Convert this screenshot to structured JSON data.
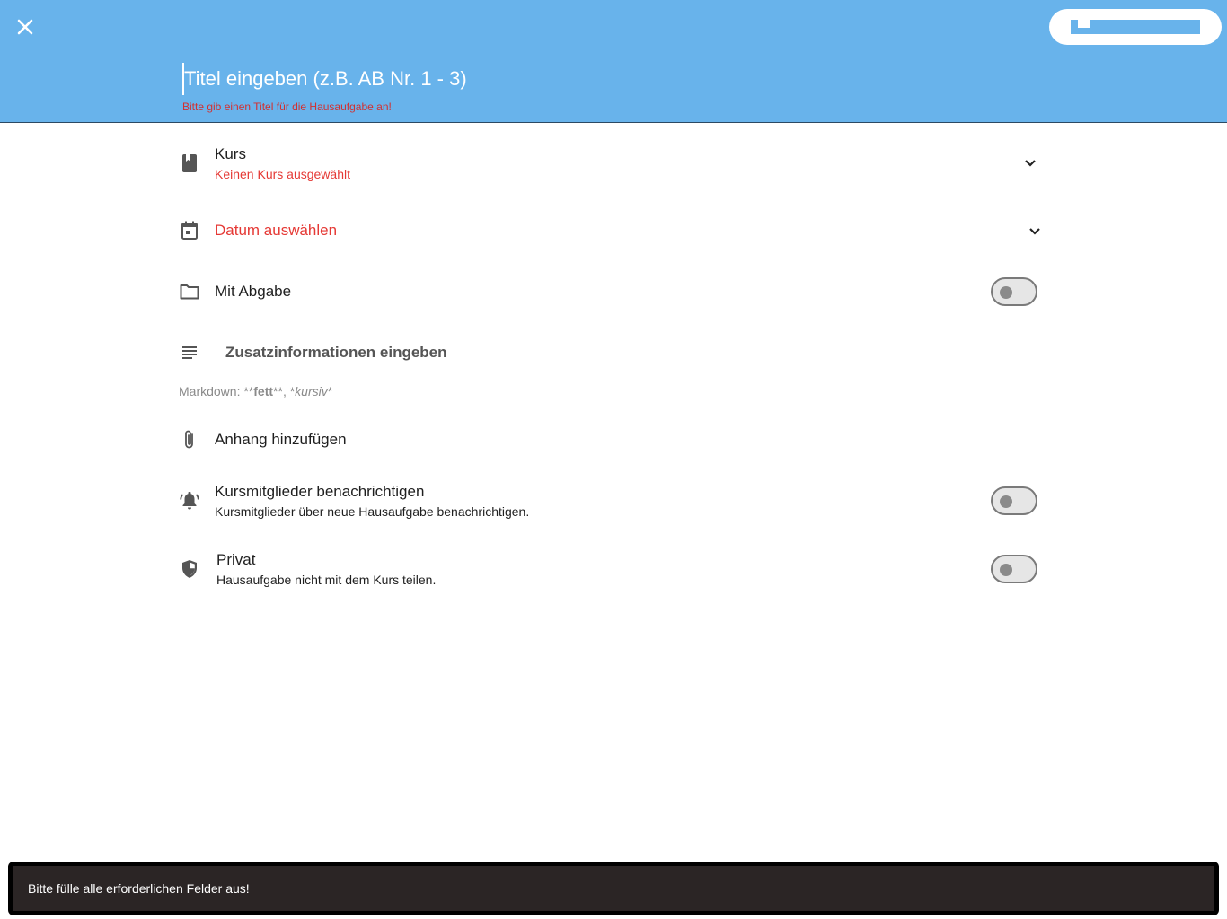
{
  "header": {
    "close_icon": "close-icon",
    "title_placeholder": "Titel eingeben (z.B. AB Nr. 1 - 3)",
    "title_error": "Bitte gib einen Titel für die Hausaufgabe an!",
    "background_color": "#68b3eb"
  },
  "form": {
    "course": {
      "icon": "book-icon",
      "label": "Kurs",
      "status": "Keinen Kurs ausgewählt"
    },
    "date": {
      "icon": "calendar-icon",
      "label": "Datum auswählen"
    },
    "submission": {
      "icon": "folder-icon",
      "label": "Mit Abgabe",
      "enabled": false
    },
    "description": {
      "icon": "notes-icon",
      "placeholder": "Zusatzinformationen eingeben",
      "markdown_prefix": "Markdown: **",
      "markdown_bold": "fett",
      "markdown_middle": "**, *",
      "markdown_italic": "kursiv",
      "markdown_suffix": "*"
    },
    "attachment": {
      "icon": "paperclip-icon",
      "label": "Anhang hinzufügen"
    },
    "notify": {
      "icon": "bell-ring-icon",
      "label": "Kursmitglieder benachrichtigen",
      "sub": "Kursmitglieder über neue Hausaufgabe benachrichtigen.",
      "enabled": false
    },
    "private": {
      "icon": "shield-icon",
      "label": "Privat",
      "sub": "Hausaufgabe nicht mit dem Kurs teilen.",
      "enabled": false
    }
  },
  "snackbar": {
    "message": "Bitte fülle alle erforderlichen Felder aus!"
  },
  "colors": {
    "error": "#e53935",
    "accent": "#68b3eb"
  }
}
